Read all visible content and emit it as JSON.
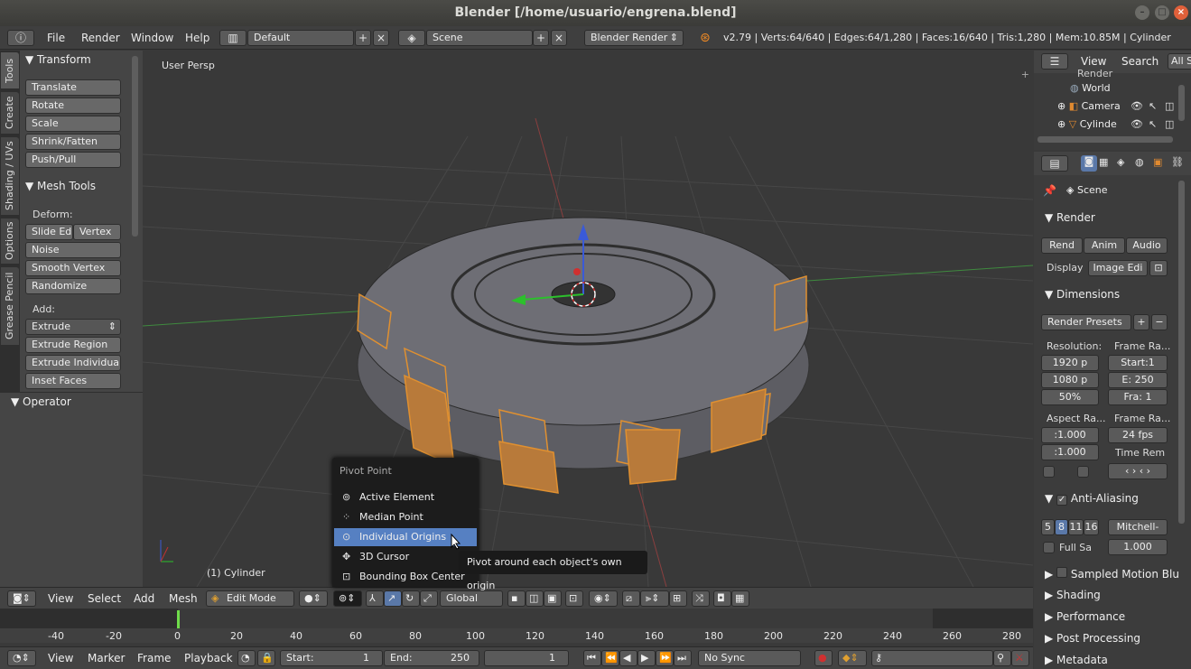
{
  "window": {
    "title": "Blender [/home/usuario/engrena.blend]"
  },
  "topbar": {
    "menus": [
      "File",
      "Render",
      "Window",
      "Help"
    ],
    "layout": "Default",
    "scene": "Scene",
    "engine": "Blender Render",
    "stats": "v2.79 | Verts:64/640 | Edges:64/1,280 | Faces:16/640 | Tris:1,280 | Mem:10.85M | Cylinder"
  },
  "tool_tabs": [
    "Tools",
    "Create",
    "Shading / UVs",
    "Options",
    "Grease Pencil"
  ],
  "toolshelf": {
    "transform": {
      "title": "Transform",
      "buttons": [
        "Translate",
        "Rotate",
        "Scale",
        "Shrink/Fatten",
        "Push/Pull"
      ]
    },
    "mesh_tools": {
      "title": "Mesh Tools",
      "deform_label": "Deform:",
      "slide_edge": "Slide Ed",
      "vertex": "Vertex",
      "buttons": [
        "Noise",
        "Smooth Vertex",
        "Randomize"
      ],
      "add_label": "Add:",
      "extrude": "Extrude",
      "add_buttons": [
        "Extrude Region",
        "Extrude Individual",
        "Inset Faces"
      ]
    }
  },
  "operator": {
    "title": "Operator"
  },
  "viewport": {
    "view_name": "User Persp",
    "object_label": "(1) Cylinder"
  },
  "outliner": {
    "view": "View",
    "search": "Search",
    "all": "All S",
    "items": [
      "Render",
      "World",
      "Camera",
      "Cylinde"
    ]
  },
  "properties": {
    "scene": "Scene",
    "render": {
      "title": "Render",
      "tabs": [
        "Rend",
        "Anim",
        "Audio"
      ],
      "display_label": "Display",
      "display_value": "Image Edi"
    },
    "dimensions": {
      "title": "Dimensions",
      "presets": "Render Presets",
      "resolution_label": "Resolution:",
      "res_x": "1920 p",
      "res_y": "1080 p",
      "res_pct": "50%",
      "frame_range_label": "Frame Ra...",
      "start": "Start:1",
      "end": "E: 250",
      "frame": "Fra:  1",
      "aspect_label": "Aspect Ra...",
      "aspect_x": ":1.000",
      "aspect_y": ":1.000",
      "frame_rate_label": "Frame Ra...",
      "fps": "24 fps",
      "time_remap": "Time Rem"
    },
    "antialiasing": {
      "title": "Anti-Aliasing",
      "samples": [
        "5",
        "8",
        "11",
        "16"
      ],
      "filter": "Mitchell-",
      "full_sample": "Full Sa",
      "size": "1.000"
    },
    "panels": [
      "Sampled Motion Blu",
      "Shading",
      "Performance",
      "Post Processing",
      "Metadata"
    ]
  },
  "view3d_header": {
    "menus": [
      "View",
      "Select",
      "Add",
      "Mesh"
    ],
    "mode": "Edit Mode",
    "orientation": "Global"
  },
  "pivot_menu": {
    "title": "Pivot Point",
    "items": [
      "Active Element",
      "Median Point",
      "Individual Origins",
      "3D Cursor",
      "Bounding Box Center"
    ],
    "highlighted": "Individual Origins"
  },
  "tooltip": {
    "text": "Pivot around each object's own origin"
  },
  "timeline": {
    "ticks": [
      "-40",
      "-20",
      "0",
      "20",
      "40",
      "60",
      "80",
      "100",
      "120",
      "140",
      "160",
      "180",
      "200",
      "220",
      "240",
      "260",
      "280"
    ],
    "current_frame": "1"
  },
  "timeline_header": {
    "menus": [
      "View",
      "Marker",
      "Frame",
      "Playback"
    ],
    "start": "Start:",
    "start_value": "1",
    "end": "End:",
    "end_value": "250",
    "frame_value": "1",
    "sync": "No Sync"
  }
}
